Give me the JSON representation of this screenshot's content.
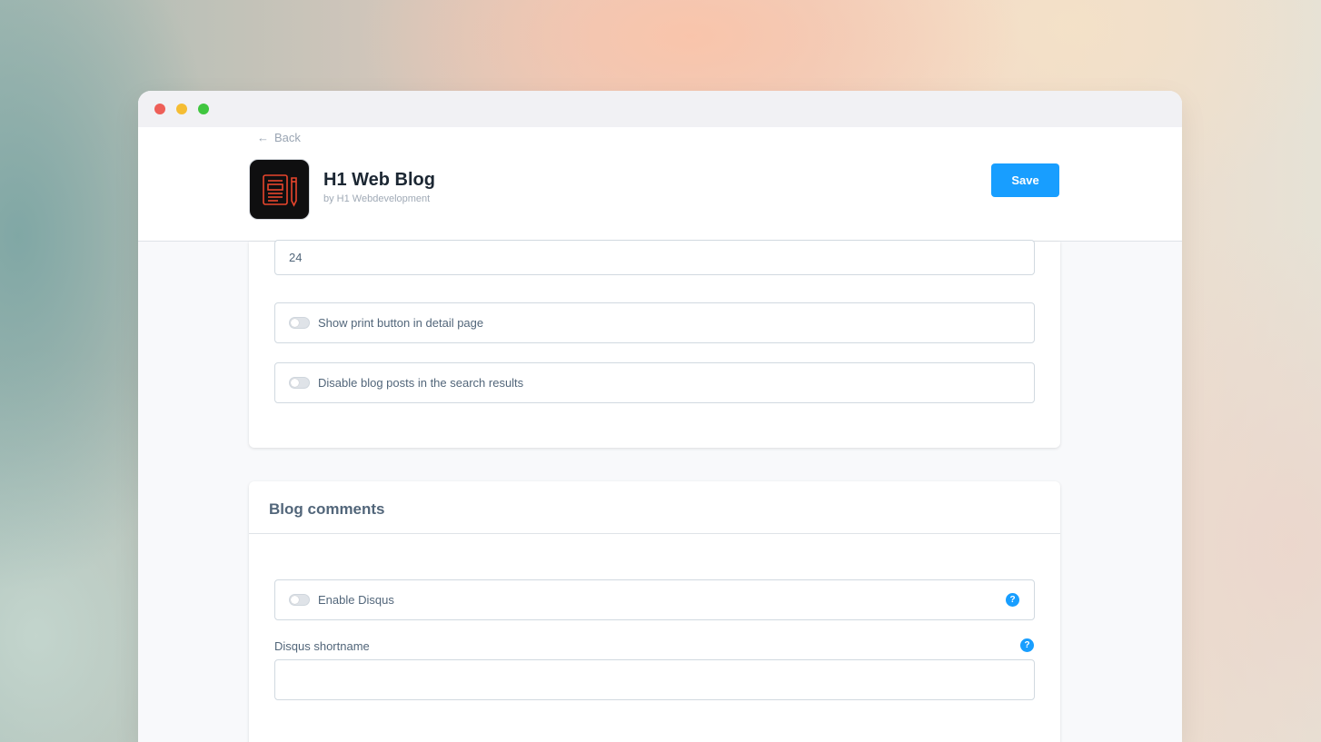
{
  "window": {
    "controls": [
      "close",
      "minimize",
      "maximize"
    ]
  },
  "header": {
    "back_label": "Back",
    "app_title": "H1 Web Blog",
    "app_vendor": "by H1 Webdevelopment",
    "save_label": "Save",
    "app_icon": "notebook-pencil-icon"
  },
  "settings": {
    "posts_per_page_value": "24",
    "show_print_button_label": "Show print button in detail page",
    "show_print_button_enabled": false,
    "disable_search_label": "Disable blog posts in the search results",
    "disable_search_enabled": false
  },
  "comments": {
    "title": "Blog comments",
    "enable_disqus_label": "Enable Disqus",
    "enable_disqus_enabled": false,
    "disqus_shortname_label": "Disqus shortname",
    "disqus_shortname_value": "",
    "help_glyph": "?"
  },
  "colors": {
    "accent": "#189eff",
    "text": "#52667a",
    "title": "#1c2733",
    "icon_stroke": "#e8452c"
  }
}
